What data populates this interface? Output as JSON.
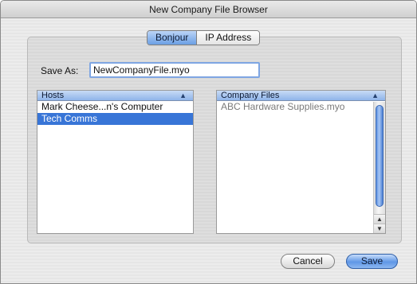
{
  "window": {
    "title": "New Company File Browser"
  },
  "tabs": [
    {
      "label": "Bonjour",
      "selected": true
    },
    {
      "label": "IP Address",
      "selected": false
    }
  ],
  "save_as": {
    "label": "Save As:",
    "value": "NewCompanyFile.myo"
  },
  "hosts": {
    "header": "Hosts",
    "items": [
      {
        "label": "Mark Cheese...n's Computer",
        "selected": false
      },
      {
        "label": "Tech Comms",
        "selected": true
      }
    ]
  },
  "company_files": {
    "header": "Company Files",
    "items": [
      {
        "label": "ABC Hardware Supplies.myo",
        "selected": false
      }
    ]
  },
  "buttons": {
    "cancel": "Cancel",
    "save": "Save"
  },
  "colors": {
    "selection": "#3875d7",
    "header_blue": "#8fb4ea",
    "default_button": "#5f97e6"
  }
}
